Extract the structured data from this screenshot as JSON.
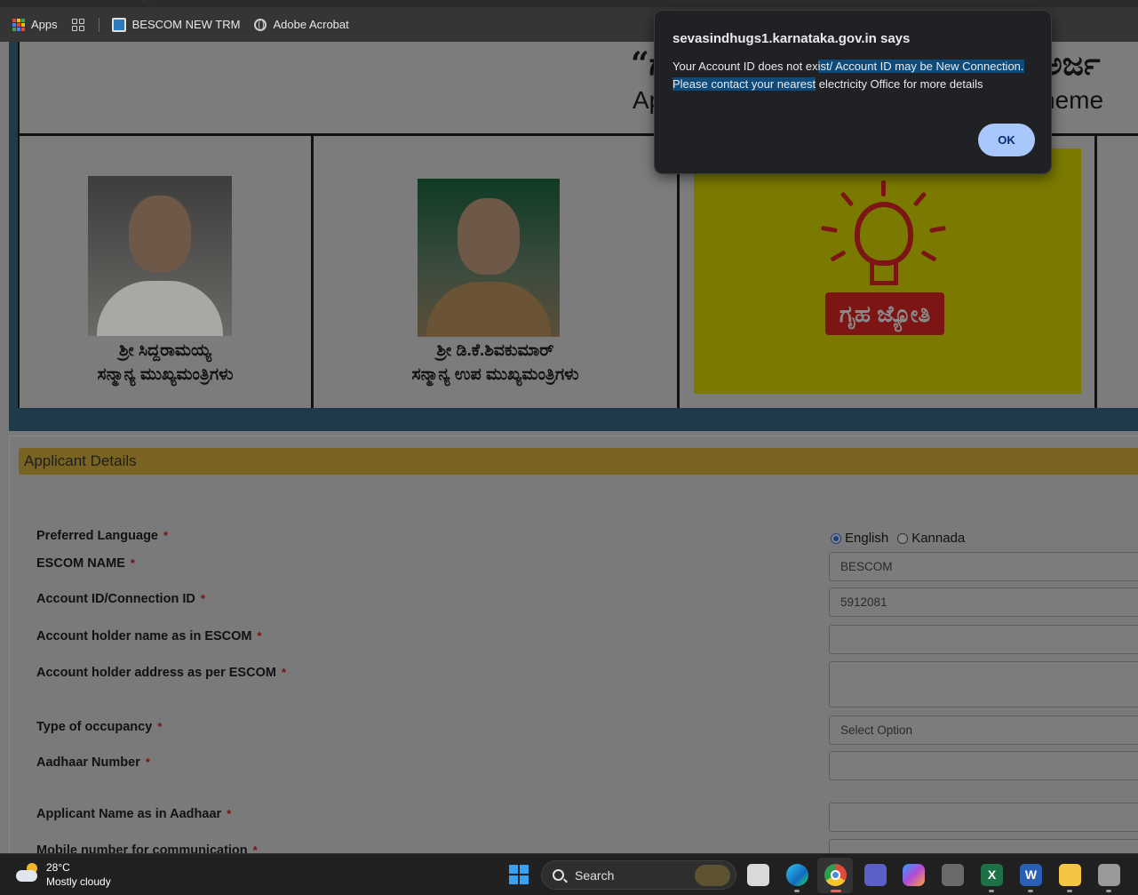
{
  "bookmarks": {
    "items": [
      {
        "label": "Apps"
      },
      {
        "label": ""
      },
      {
        "label": "BESCOM NEW TRM"
      },
      {
        "label": "Adobe Acrobat"
      }
    ]
  },
  "banner": {
    "title_line1_left": "“ಗ",
    "title_line1_right": "ಅರ್ಜ",
    "title_line2_left": "Ap",
    "title_line2_right": "heme",
    "person1": {
      "name": "ಶ್ರೀ ಸಿದ್ದರಾಮಯ್ಯ",
      "title": "ಸನ್ಮಾನ್ಯ ಮುಖ್ಯಮಂತ್ರಿಗಳು"
    },
    "person2": {
      "name": "ಶ್ರೀ ಡಿ.ಕೆ.ಶಿವಕುಮಾರ್",
      "title": "ಸನ್ಮಾನ್ಯ ಉಪ ಮುಖ್ಯಮಂತ್ರಿಗಳು"
    },
    "logo_text": "ಗೃಹ ಜ್ಯೋತಿ"
  },
  "form": {
    "section_title": "Applicant Details",
    "required_mark": "*",
    "labels": {
      "preferred_language": "Preferred Language",
      "escom_name": "ESCOM NAME",
      "account_id": "Account ID/Connection ID",
      "holder_name": "Account holder name as in ESCOM",
      "holder_address": "Account holder address as per ESCOM",
      "occupancy": "Type of occupancy",
      "aadhaar": "Aadhaar Number",
      "applicant_name": "Applicant Name as in Aadhaar",
      "mobile": "Mobile number for communication"
    },
    "language_options": [
      "English",
      "Kannada"
    ],
    "selected_language": "English",
    "values": {
      "escom_name": "BESCOM",
      "account_id": "5912081",
      "holder_name": "",
      "holder_address": "",
      "occupancy": "Select Option",
      "aadhaar": "",
      "applicant_name": "",
      "mobile": ""
    }
  },
  "dialog": {
    "title": "sevasindhugs1.karnataka.gov.in says",
    "message_part1": "Your Account ID does not ex",
    "message_highlight": "ist/ Account ID may be New Connection. Please contact your nearest",
    "message_part2": " electricity Office for more details",
    "ok_label": "OK"
  },
  "taskbar": {
    "temperature": "28°C",
    "condition": "Mostly cloudy",
    "search_label": "Search"
  }
}
